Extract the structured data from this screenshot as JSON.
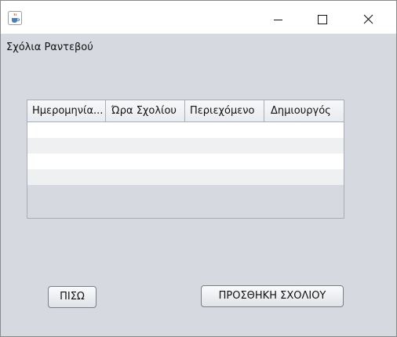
{
  "window": {
    "title": "",
    "icons": {
      "app": "java-cup-icon",
      "minimize": "minimize-icon",
      "maximize": "maximize-icon",
      "close": "close-icon"
    }
  },
  "heading": "Σχόλια Ραντεβού",
  "table": {
    "columns": [
      "Ημερομηνία...",
      "Ώρα Σχολίου",
      "Περιεχόμενο",
      "Δημιουργός"
    ],
    "rows": [
      [
        "",
        "",
        "",
        ""
      ],
      [
        "",
        "",
        "",
        ""
      ],
      [
        "",
        "",
        "",
        ""
      ],
      [
        "",
        "",
        "",
        ""
      ]
    ]
  },
  "buttons": {
    "back": "ΠΙΣΩ",
    "add_comment": "ΠΡΟΣΘΗΚΗ ΣΧΟΛΙΟΥ"
  },
  "colors": {
    "background": "#d6d9df",
    "row_alt": "#eff0f1",
    "border": "#a9aeb6"
  }
}
